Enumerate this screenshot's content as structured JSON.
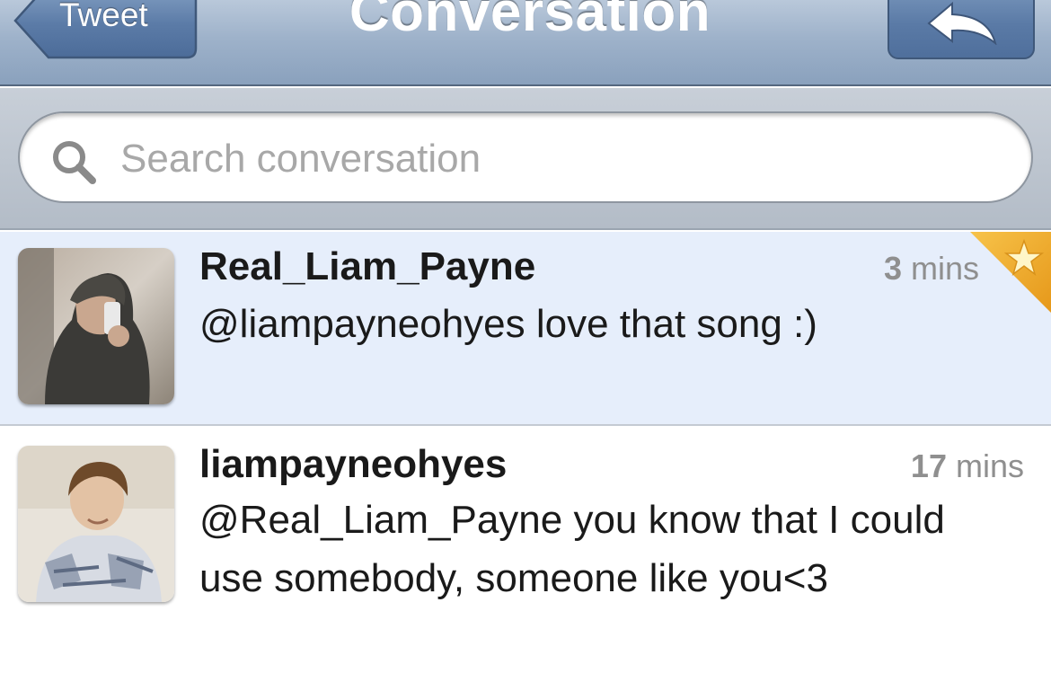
{
  "navbar": {
    "back_label": "Tweet",
    "title": "Conversation",
    "reply_icon": "reply-arrow-icon"
  },
  "search": {
    "placeholder": "Search conversation",
    "value": "",
    "icon": "search-icon"
  },
  "tweets": [
    {
      "username": "Real_Liam_Payne",
      "time_number": "3",
      "time_unit": "mins",
      "text": "@liampayneohyes love that song :)",
      "favorited": true,
      "highlighted": true
    },
    {
      "username": "liampayneohyes",
      "time_number": "17",
      "time_unit": "mins",
      "text": "@Real_Liam_Payne you know that I could use somebody, someone like you<3",
      "favorited": false,
      "highlighted": false
    }
  ],
  "colors": {
    "navbar": "#9eb2ca",
    "highlight_row": "#e6eefb",
    "favorite_star": "#f5b21e"
  }
}
